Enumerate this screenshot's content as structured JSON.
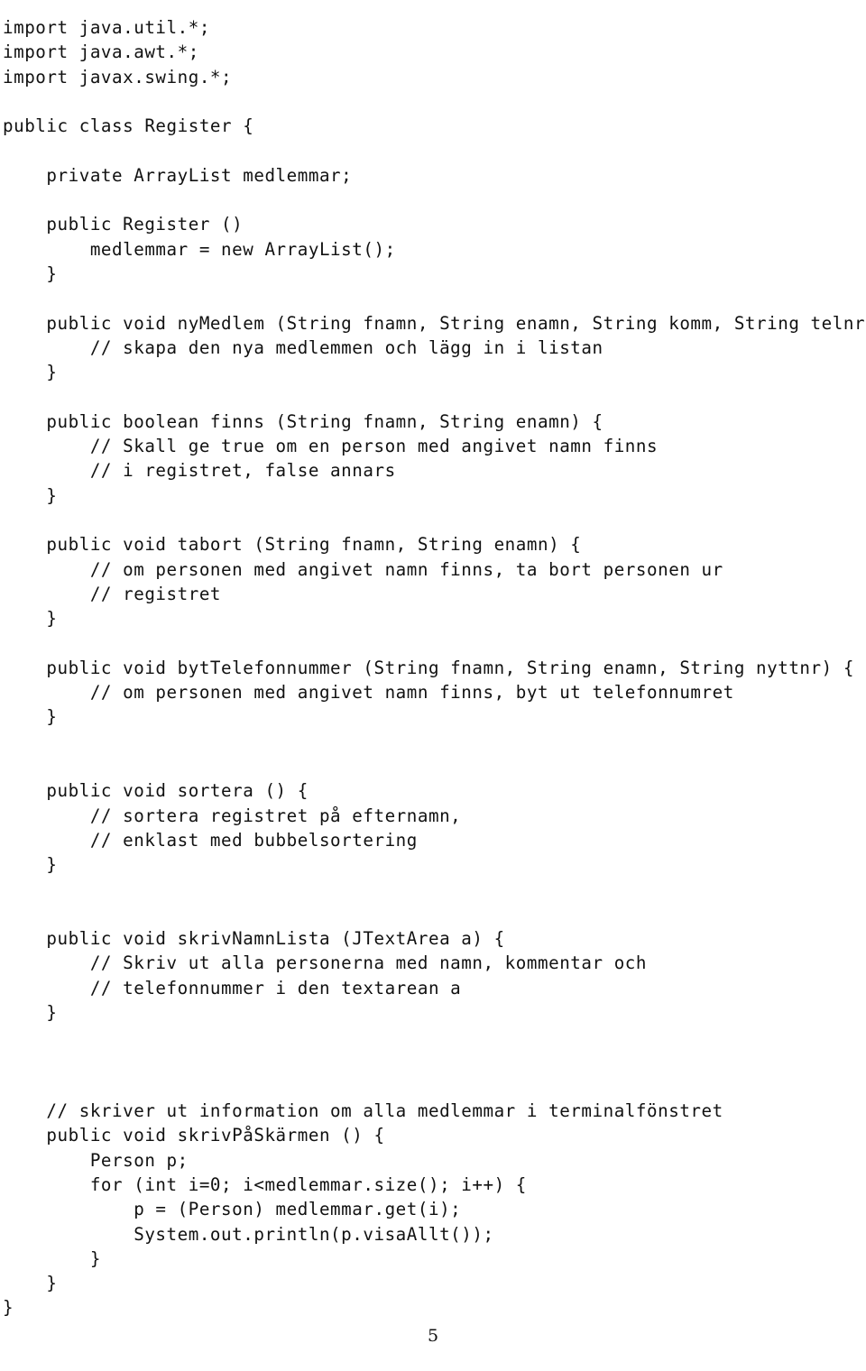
{
  "document": {
    "kind": "java-source-listing",
    "language": "Java",
    "class_name": "Register",
    "page_number": "5",
    "background_color": "#ffffff",
    "text_color": "#111111"
  },
  "code": {
    "lines": [
      "import java.util.*;",
      "import java.awt.*;",
      "import javax.swing.*;",
      "",
      "public class Register {",
      "",
      "    private ArrayList medlemmar;",
      "",
      "    public Register ()",
      "        medlemmar = new ArrayList();",
      "    }",
      "",
      "    public void nyMedlem (String fnamn, String enamn, String komm, String telnr){",
      "        // skapa den nya medlemmen och lägg in i listan",
      "    }",
      "",
      "    public boolean finns (String fnamn, String enamn) {",
      "        // Skall ge true om en person med angivet namn finns",
      "        // i registret, false annars",
      "    }",
      "",
      "    public void tabort (String fnamn, String enamn) {",
      "        // om personen med angivet namn finns, ta bort personen ur",
      "        // registret",
      "    }",
      "",
      "    public void bytTelefonnummer (String fnamn, String enamn, String nyttnr) {",
      "        // om personen med angivet namn finns, byt ut telefonnumret",
      "    }",
      "",
      "",
      "    public void sortera () {",
      "        // sortera registret på efternamn,",
      "        // enklast med bubbelsortering",
      "    }",
      "",
      "",
      "    public void skrivNamnLista (JTextArea a) {",
      "        // Skriv ut alla personerna med namn, kommentar och",
      "        // telefonnummer i den textarean a",
      "    }",
      "",
      "",
      "",
      "    // skriver ut information om alla medlemmar i terminalfönstret",
      "    public void skrivPåSkärmen () {",
      "        Person p;",
      "        for (int i=0; i<medlemmar.size(); i++) {",
      "            p = (Person) medlemmar.get(i);",
      "            System.out.println(p.visaAllt());",
      "        }",
      "    }",
      "}"
    ]
  },
  "footer": {
    "page_label": "5"
  }
}
